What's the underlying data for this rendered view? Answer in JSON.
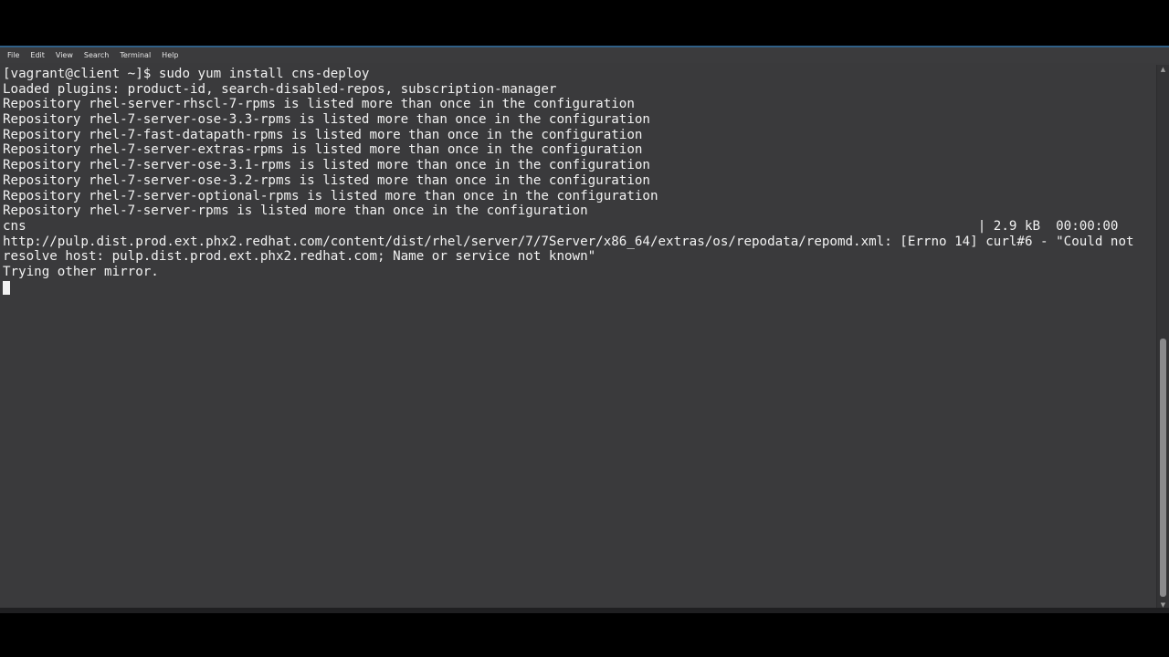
{
  "menubar": {
    "items": [
      "File",
      "Edit",
      "View",
      "Search",
      "Terminal",
      "Help"
    ]
  },
  "terminal": {
    "lines": [
      "[vagrant@client ~]$ sudo yum install cns-deploy",
      "Loaded plugins: product-id, search-disabled-repos, subscription-manager",
      "Repository rhel-server-rhscl-7-rpms is listed more than once in the configuration",
      "Repository rhel-7-server-ose-3.3-rpms is listed more than once in the configuration",
      "Repository rhel-7-fast-datapath-rpms is listed more than once in the configuration",
      "Repository rhel-7-server-extras-rpms is listed more than once in the configuration",
      "Repository rhel-7-server-ose-3.1-rpms is listed more than once in the configuration",
      "Repository rhel-7-server-ose-3.2-rpms is listed more than once in the configuration",
      "Repository rhel-7-server-optional-rpms is listed more than once in the configuration",
      "Repository rhel-7-server-rpms is listed more than once in the configuration",
      "cns                                                                                                                          | 2.9 kB  00:00:00",
      "http://pulp.dist.prod.ext.phx2.redhat.com/content/dist/rhel/server/7/7Server/x86_64/extras/os/repodata/repomd.xml: [Errno 14] curl#6 - \"Could not",
      "resolve host: pulp.dist.prod.ext.phx2.redhat.com; Name or service not known\"",
      "Trying other mirror."
    ]
  },
  "colors": {
    "background": "#3a3a3c",
    "text": "#f2f2f2",
    "title_accent": "#2f5f86"
  },
  "icons": {
    "scroll_up": "arrow-up-icon",
    "scroll_down": "arrow-down-icon"
  }
}
